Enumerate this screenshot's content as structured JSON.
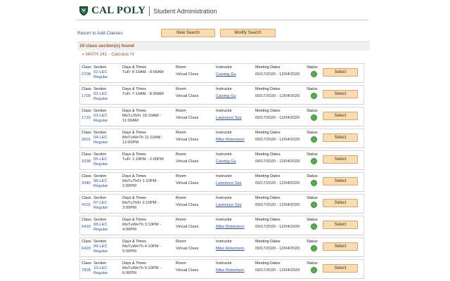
{
  "header": {
    "brand": "CAL POLY",
    "subtitle": "Student Administration"
  },
  "nav": {
    "return_link": "Return to Add Classes",
    "new_search": "New Search",
    "modify_search": "Modify Search"
  },
  "results": {
    "found_text": "10 class section(s) found",
    "course_title": "MATH 241 - Calculus IV"
  },
  "columns": {
    "class": "Class",
    "section": "Section",
    "days_times": "Days & Times",
    "room": "Room",
    "instructor": "Instructor",
    "meeting_dates": "Meeting Dates",
    "status": "Status"
  },
  "select_label": "Select",
  "sections": [
    {
      "class": "2708",
      "section_line1": "01-LEC",
      "section_line2": "Regular",
      "days_line1": "TuFr 8:10AM - 9:00AM",
      "days_line2": "",
      "room": "Virtual Class",
      "instructor": "Caixing Gu",
      "dates": "09/17/2020 - 12/04/2020",
      "status_color": "#52b04a"
    },
    {
      "class": "1709",
      "section_line1": "02-LEC",
      "section_line2": "Regular",
      "days_line1": "TuFr 7:10AM - 8:00AM",
      "days_line2": "",
      "room": "Virtual Class",
      "instructor": "Caixing Gu",
      "dates": "09/17/2020 - 12/04/2020",
      "status_color": "#52b04a"
    },
    {
      "class": "1710",
      "section_line1": "03-LEC",
      "section_line2": "Regular",
      "days_line1": "MoTuThFr 10:10AM -",
      "days_line2": "11:00AM",
      "room": "Virtual Class",
      "instructor": "Lawrence Sze",
      "dates": "09/17/2020 - 12/04/2020",
      "status_color": "#52b04a"
    },
    {
      "class": "3601",
      "section_line1": "04-LEC",
      "section_line2": "Regular",
      "days_line1": "MoTuWeTh 11:10AM -",
      "days_line2": "12:00PM",
      "room": "Virtual Class",
      "instructor": "Mike Robertson",
      "dates": "09/17/2020 - 12/04/2020",
      "status_color": "#52b04a"
    },
    {
      "class": "3338",
      "section_line1": "05-LEC",
      "section_line2": "Regular",
      "days_line1": "TuFr 1:10PM - 2:00PM",
      "days_line2": "",
      "room": "Virtual Class",
      "instructor": "Caixing Gu",
      "dates": "09/17/2020 - 12/04/2020",
      "status_color": "#52b04a"
    },
    {
      "class": "3340",
      "section_line1": "06-LEC",
      "section_line2": "Regular",
      "days_line1": "MoTuThFr 1:10PM -",
      "days_line2": "2:00PM",
      "room": "Virtual Class",
      "instructor": "Lawrence Sze",
      "dates": "09/17/2020 - 12/04/2020",
      "status_color": "#52b04a"
    },
    {
      "class": "4101",
      "section_line1": "07-LEC",
      "section_line2": "Regular",
      "days_line1": "MoTuThFr 2:10PM -",
      "days_line2": "3:00PM",
      "room": "Virtual Class",
      "instructor": "Lawrence Sze",
      "dates": "09/17/2020 - 12/04/2020",
      "status_color": "#52b04a"
    },
    {
      "class": "6410",
      "section_line1": "08-LEC",
      "section_line2": "Regular",
      "days_line1": "MoTuWeTh 3:10PM -",
      "days_line2": "4:00PM",
      "room": "Virtual Class",
      "instructor": "Mike Robertson",
      "dates": "09/17/2020 - 12/04/2020",
      "status_color": "#52b04a"
    },
    {
      "class": "6420",
      "section_line1": "09-LEC",
      "section_line2": "Regular",
      "days_line1": "MoTuWeTh 4:10PM -",
      "days_line2": "5:00PM",
      "room": "Virtual Class",
      "instructor": "Mike Robertson",
      "dates": "09/17/2020 - 12/04/2020",
      "status_color": "#52b04a"
    },
    {
      "class": "7828",
      "section_line1": "10-LEC",
      "section_line2": "Regular",
      "days_line1": "MoTuWeTh 5:10PM -",
      "days_line2": "6:00PM",
      "room": "Virtual Class",
      "instructor": "Mike Robertson",
      "dates": "09/17/2020 - 12/04/2020",
      "status_color": "#52b04a"
    }
  ]
}
